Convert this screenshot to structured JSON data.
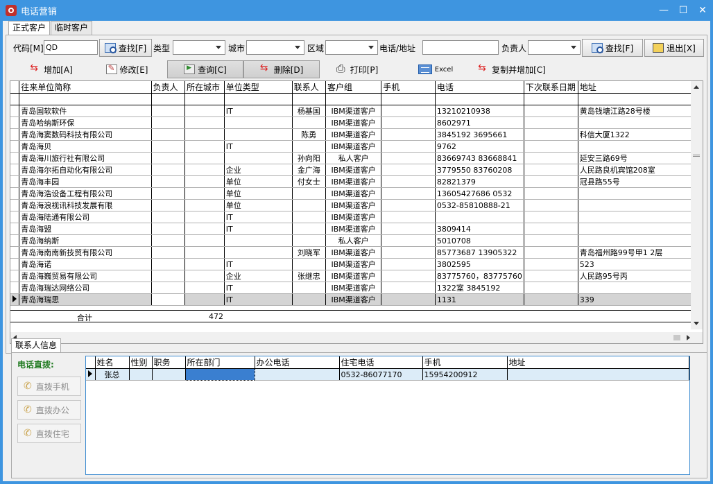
{
  "window": {
    "title": "电话营销"
  },
  "tabs": [
    "正式客户",
    "临时客户"
  ],
  "filters": {
    "code_label": "代码[M]",
    "code_value": "QD",
    "search_label": "查找[F]",
    "type_label": "类型",
    "city_label": "城市",
    "area_label": "区域",
    "phone_addr_label": "电话/地址",
    "owner_label": "负责人",
    "search2_label": "查找[F]",
    "exit_label": "退出[X]"
  },
  "toolbar": {
    "add": "增加[A]",
    "edit": "修改[E]",
    "query": "查询[C]",
    "delete": "删除[D]",
    "print": "打印[P]",
    "excel": "Excel",
    "copy_add": "复制并增加[C]"
  },
  "grid": {
    "columns": [
      "往来单位简称",
      "负责人",
      "所在城市",
      "单位类型",
      "联系人",
      "客户组",
      "手机",
      "电话",
      "下次联系日期",
      "地址"
    ],
    "rows": [
      [
        "青岛国软软件",
        "",
        "",
        "IT",
        "杨基国",
        "IBM渠道客户",
        "",
        "13210210938",
        "",
        "黄岛钱塘江路28号楼"
      ],
      [
        "青岛哈纳斯环保",
        "",
        "",
        "",
        "",
        "IBM渠道客户",
        "",
        "8602971",
        "",
        ""
      ],
      [
        "青岛海窦数码科技有限公司",
        "",
        "",
        "",
        "陈勇",
        "IBM渠道客户",
        "",
        "3845192 3695661",
        "",
        "科信大厦1322"
      ],
      [
        "青岛海贝",
        "",
        "",
        "IT",
        "",
        "IBM渠道客户",
        "",
        "9762",
        "",
        ""
      ],
      [
        "青岛海川旅行社有限公司",
        "",
        "",
        "",
        "孙向阳",
        "私人客户",
        "",
        "83669743 83668841",
        "",
        "延安三路69号"
      ],
      [
        "青岛海尔拓自动化有限公司",
        "",
        "",
        "企业",
        "金广海",
        "IBM渠道客户",
        "",
        "3779550 83760208",
        "",
        "人民路良机宾馆208室"
      ],
      [
        "青岛海丰园",
        "",
        "",
        "单位",
        "付女士",
        "IBM渠道客户",
        "",
        "82821379",
        "",
        "冠县路55号"
      ],
      [
        "青岛海浩设备工程有限公司",
        "",
        "",
        "单位",
        "",
        "IBM渠道客户",
        "",
        "13605427686   0532",
        "",
        ""
      ],
      [
        "青岛海浪视讯科技发展有限",
        "",
        "",
        "单位",
        "",
        "IBM渠道客户",
        "",
        "0532-85810888-21",
        "",
        ""
      ],
      [
        "青岛海陆通有限公司",
        "",
        "",
        "IT",
        "",
        "IBM渠道客户",
        "",
        "",
        "",
        ""
      ],
      [
        "青岛海盟",
        "",
        "",
        "IT",
        "",
        "IBM渠道客户",
        "",
        "3809414",
        "",
        ""
      ],
      [
        "青岛海纳斯",
        "",
        "",
        "",
        "",
        "私人客户",
        "",
        "5010708",
        "",
        ""
      ],
      [
        "青岛海南南新技贸有限公司",
        "",
        "",
        "",
        "刘晓军",
        "IBM渠道客户",
        "",
        "85773687 13905322",
        "",
        "青岛福州路99号甲1  2层"
      ],
      [
        "青岛海诺",
        "",
        "",
        "IT",
        "",
        "IBM渠道客户",
        "",
        "3802595",
        "",
        "523"
      ],
      [
        "青岛海巍贸易有限公司",
        "",
        "",
        "企业",
        "张继忠",
        "IBM渠道客户",
        "",
        "83775760，83775760",
        "",
        "人民路95号丙"
      ],
      [
        "青岛海瑞达网络公司",
        "",
        "",
        "IT",
        "",
        "IBM渠道客户",
        "",
        "1322室  3845192",
        "",
        ""
      ],
      [
        "青岛海瑞思",
        "",
        "",
        "IT",
        "",
        "IBM渠道客户",
        "",
        "1131",
        "",
        "339"
      ]
    ],
    "total_label": "合计",
    "total_value": "472"
  },
  "contacts": {
    "tab": "联系人信息",
    "dial_title": "电话直拨:",
    "dial_mobile": "直拨手机",
    "dial_office": "直拨办公",
    "dial_home": "直拨住宅",
    "columns": [
      "姓名",
      "性别",
      "职务",
      "所在部门",
      "办公电话",
      "住宅电话",
      "手机",
      "地址"
    ],
    "rows": [
      [
        "张总",
        "",
        "",
        "",
        "",
        "0532-86077170",
        "15954200912",
        ""
      ]
    ]
  }
}
